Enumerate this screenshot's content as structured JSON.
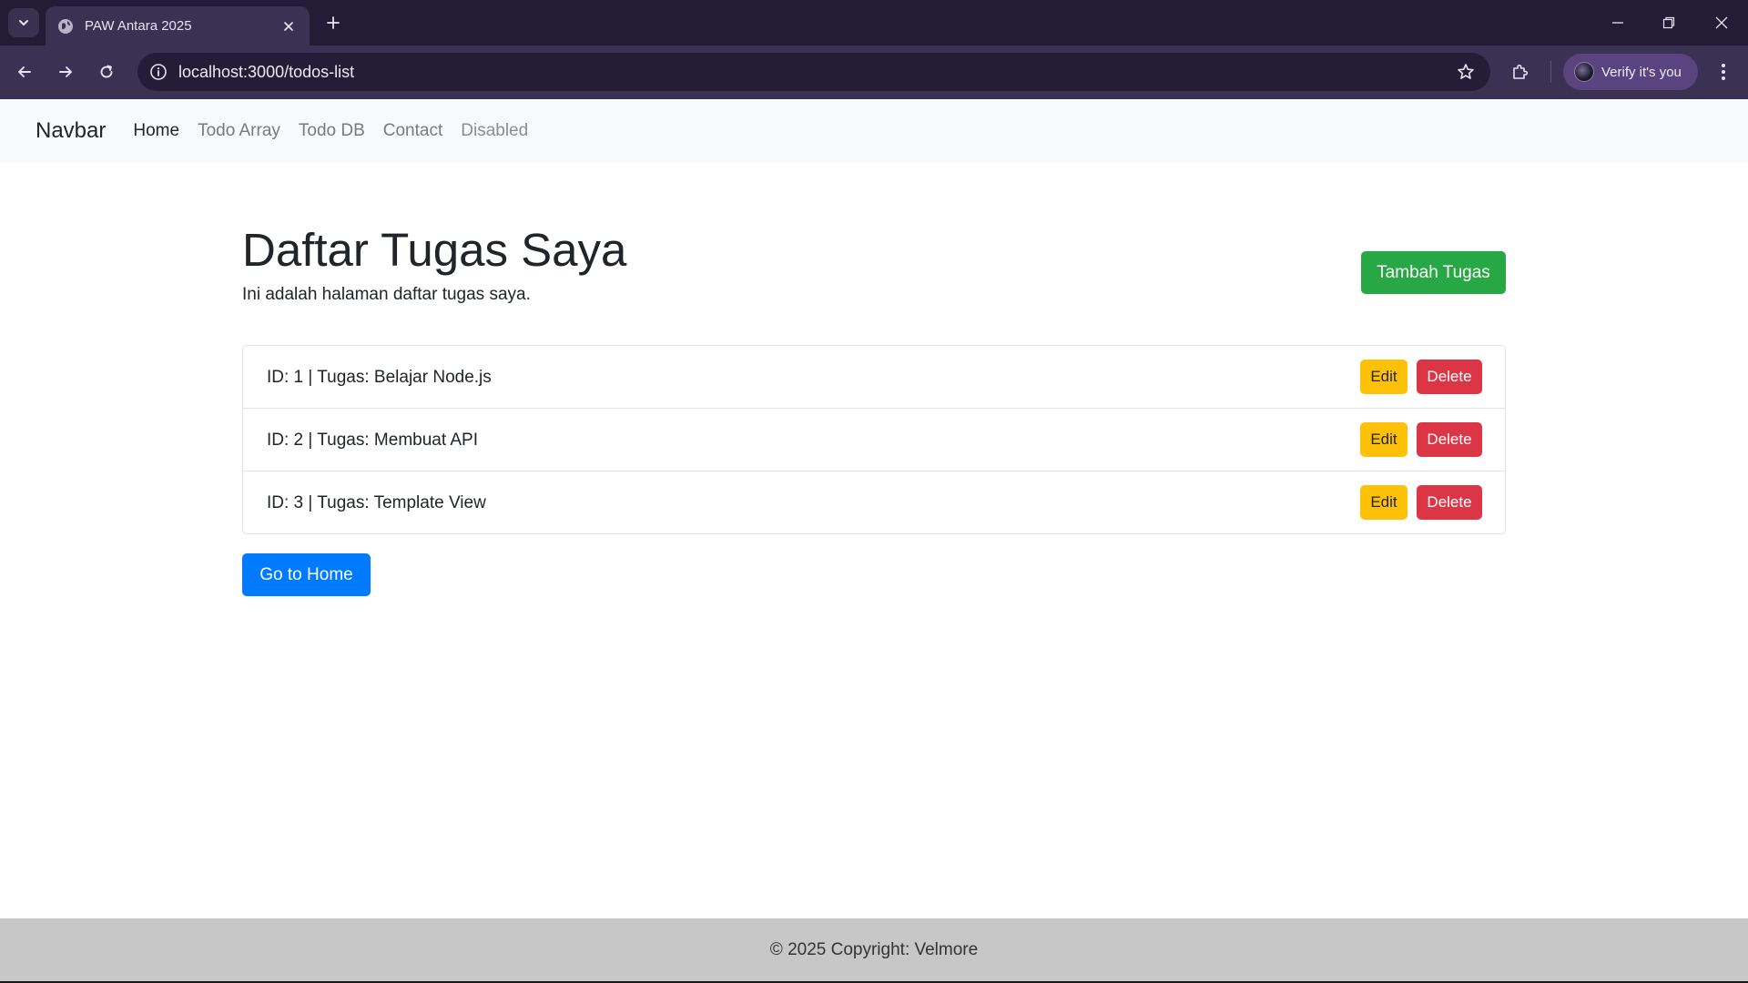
{
  "browser": {
    "tab_title": "PAW Antara 2025",
    "url": "localhost:3000/todos-list",
    "verify_label": "Verify it's you",
    "icons": [
      "tab-search-icon",
      "globe-icon",
      "close-icon",
      "plus-icon",
      "minimize-icon",
      "restore-icon",
      "window-close-icon",
      "back-arrow-icon",
      "forward-arrow-icon",
      "reload-icon",
      "info-icon",
      "star-icon",
      "extensions-icon",
      "more-vert-icon"
    ]
  },
  "navbar": {
    "brand": "Navbar",
    "links": [
      {
        "label": "Home",
        "state": "active"
      },
      {
        "label": "Todo Array",
        "state": "normal"
      },
      {
        "label": "Todo DB",
        "state": "normal"
      },
      {
        "label": "Contact",
        "state": "normal"
      },
      {
        "label": "Disabled",
        "state": "disabled"
      }
    ]
  },
  "main": {
    "title": "Daftar Tugas Saya",
    "subtitle": "Ini adalah halaman daftar tugas saya.",
    "add_button": "Tambah Tugas",
    "todos": [
      {
        "text": "ID: 1 | Tugas: Belajar Node.js",
        "edit_label": "Edit",
        "delete_label": "Delete"
      },
      {
        "text": "ID: 2 | Tugas: Membuat API",
        "edit_label": "Edit",
        "delete_label": "Delete"
      },
      {
        "text": "ID: 3 | Tugas: Template View",
        "edit_label": "Edit",
        "delete_label": "Delete"
      }
    ],
    "home_button": "Go to Home"
  },
  "footer": {
    "text": "© 2025 Copyright: Velmore"
  },
  "colors": {
    "success": "#28a745",
    "warning": "#ffc107",
    "danger": "#dc3545",
    "primary": "#007bff",
    "chrome_dark": "#241c36",
    "chrome_toolbar": "#3b3152"
  }
}
